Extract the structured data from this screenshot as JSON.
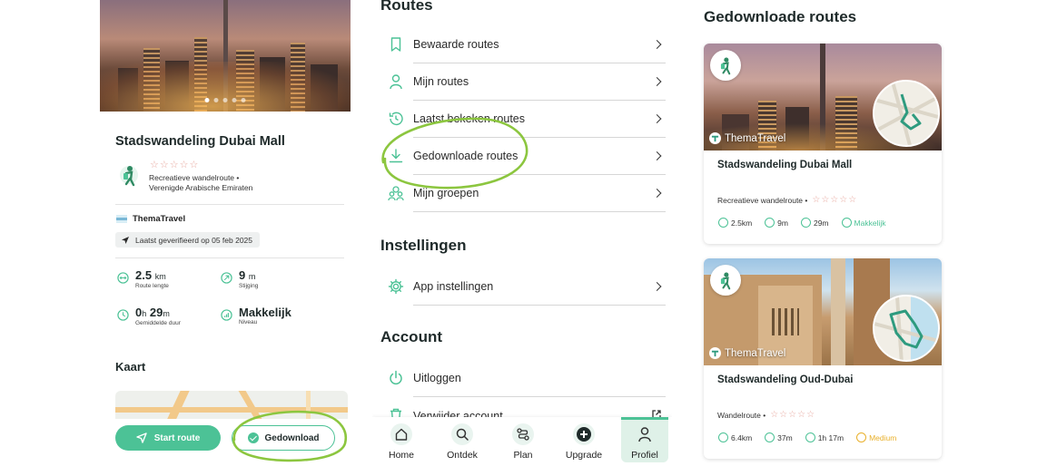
{
  "left": {
    "route_title": "Stadswandeling Dubai Mall",
    "rating_stars": "☆☆☆☆☆",
    "route_type": "Recreatieve wandelroute  •",
    "country": "Verenigde Arabische Emiraten",
    "publisher": "ThemaTravel",
    "verified": "Laatst geverifieerd op 05 feb 2025",
    "stats": {
      "length_value": "2.5",
      "length_unit": "km",
      "length_label": "Route lengte",
      "climb_value": "9",
      "climb_unit": "m",
      "climb_label": "Stijging",
      "duration_h": "0",
      "duration_h_unit": "h",
      "duration_m": "29",
      "duration_m_unit": "m",
      "duration_label": "Gemiddelde duur",
      "level_value": "Makkelijk",
      "level_label": "Niveau"
    },
    "map_heading": "Kaart",
    "start_button": "Start route",
    "downloaded_button": "Gedownload"
  },
  "middle": {
    "routes_heading": "Routes",
    "routes_items": [
      {
        "label": "Bewaarde routes",
        "icon": "bookmark-icon"
      },
      {
        "label": "Mijn routes",
        "icon": "person-icon"
      },
      {
        "label": "Laatst bekeken routes",
        "icon": "history-icon"
      },
      {
        "label": "Gedownloade routes",
        "icon": "download-icon"
      },
      {
        "label": "Mijn groepen",
        "icon": "group-icon"
      }
    ],
    "settings_heading": "Instellingen",
    "settings_items": [
      {
        "label": "App instellingen",
        "icon": "gear-icon"
      }
    ],
    "account_heading": "Account",
    "account_items": [
      {
        "label": "Uitloggen",
        "icon": "power-icon"
      },
      {
        "label": "Verwijder account",
        "icon": "trash-icon"
      }
    ],
    "tabs": [
      {
        "label": "Home"
      },
      {
        "label": "Ontdek"
      },
      {
        "label": "Plan"
      },
      {
        "label": "Upgrade"
      },
      {
        "label": "Profiel"
      }
    ]
  },
  "right": {
    "heading": "Gedownloade routes",
    "cards": [
      {
        "brand": "ThemaTravel",
        "title": "Stadswandeling Dubai Mall",
        "type": "Recreatieve wandelroute  •",
        "stars": "☆☆☆☆☆",
        "distance": "2.5km",
        "climb": "9m",
        "duration": "29m",
        "level": "Makkelijk",
        "level_color": "#4cc296"
      },
      {
        "brand": "ThemaTravel",
        "title": "Stadswandeling Oud-Dubai",
        "type": "Wandelroute  •",
        "stars": "☆☆☆☆☆",
        "distance": "6.4km",
        "climb": "37m",
        "duration": "1h 17m",
        "level": "Medium",
        "level_color": "#e9b02b"
      }
    ]
  },
  "colors": {
    "accent": "#4cc296",
    "highlight_circle": "#8cc63f",
    "star": "#e8a9a0"
  }
}
